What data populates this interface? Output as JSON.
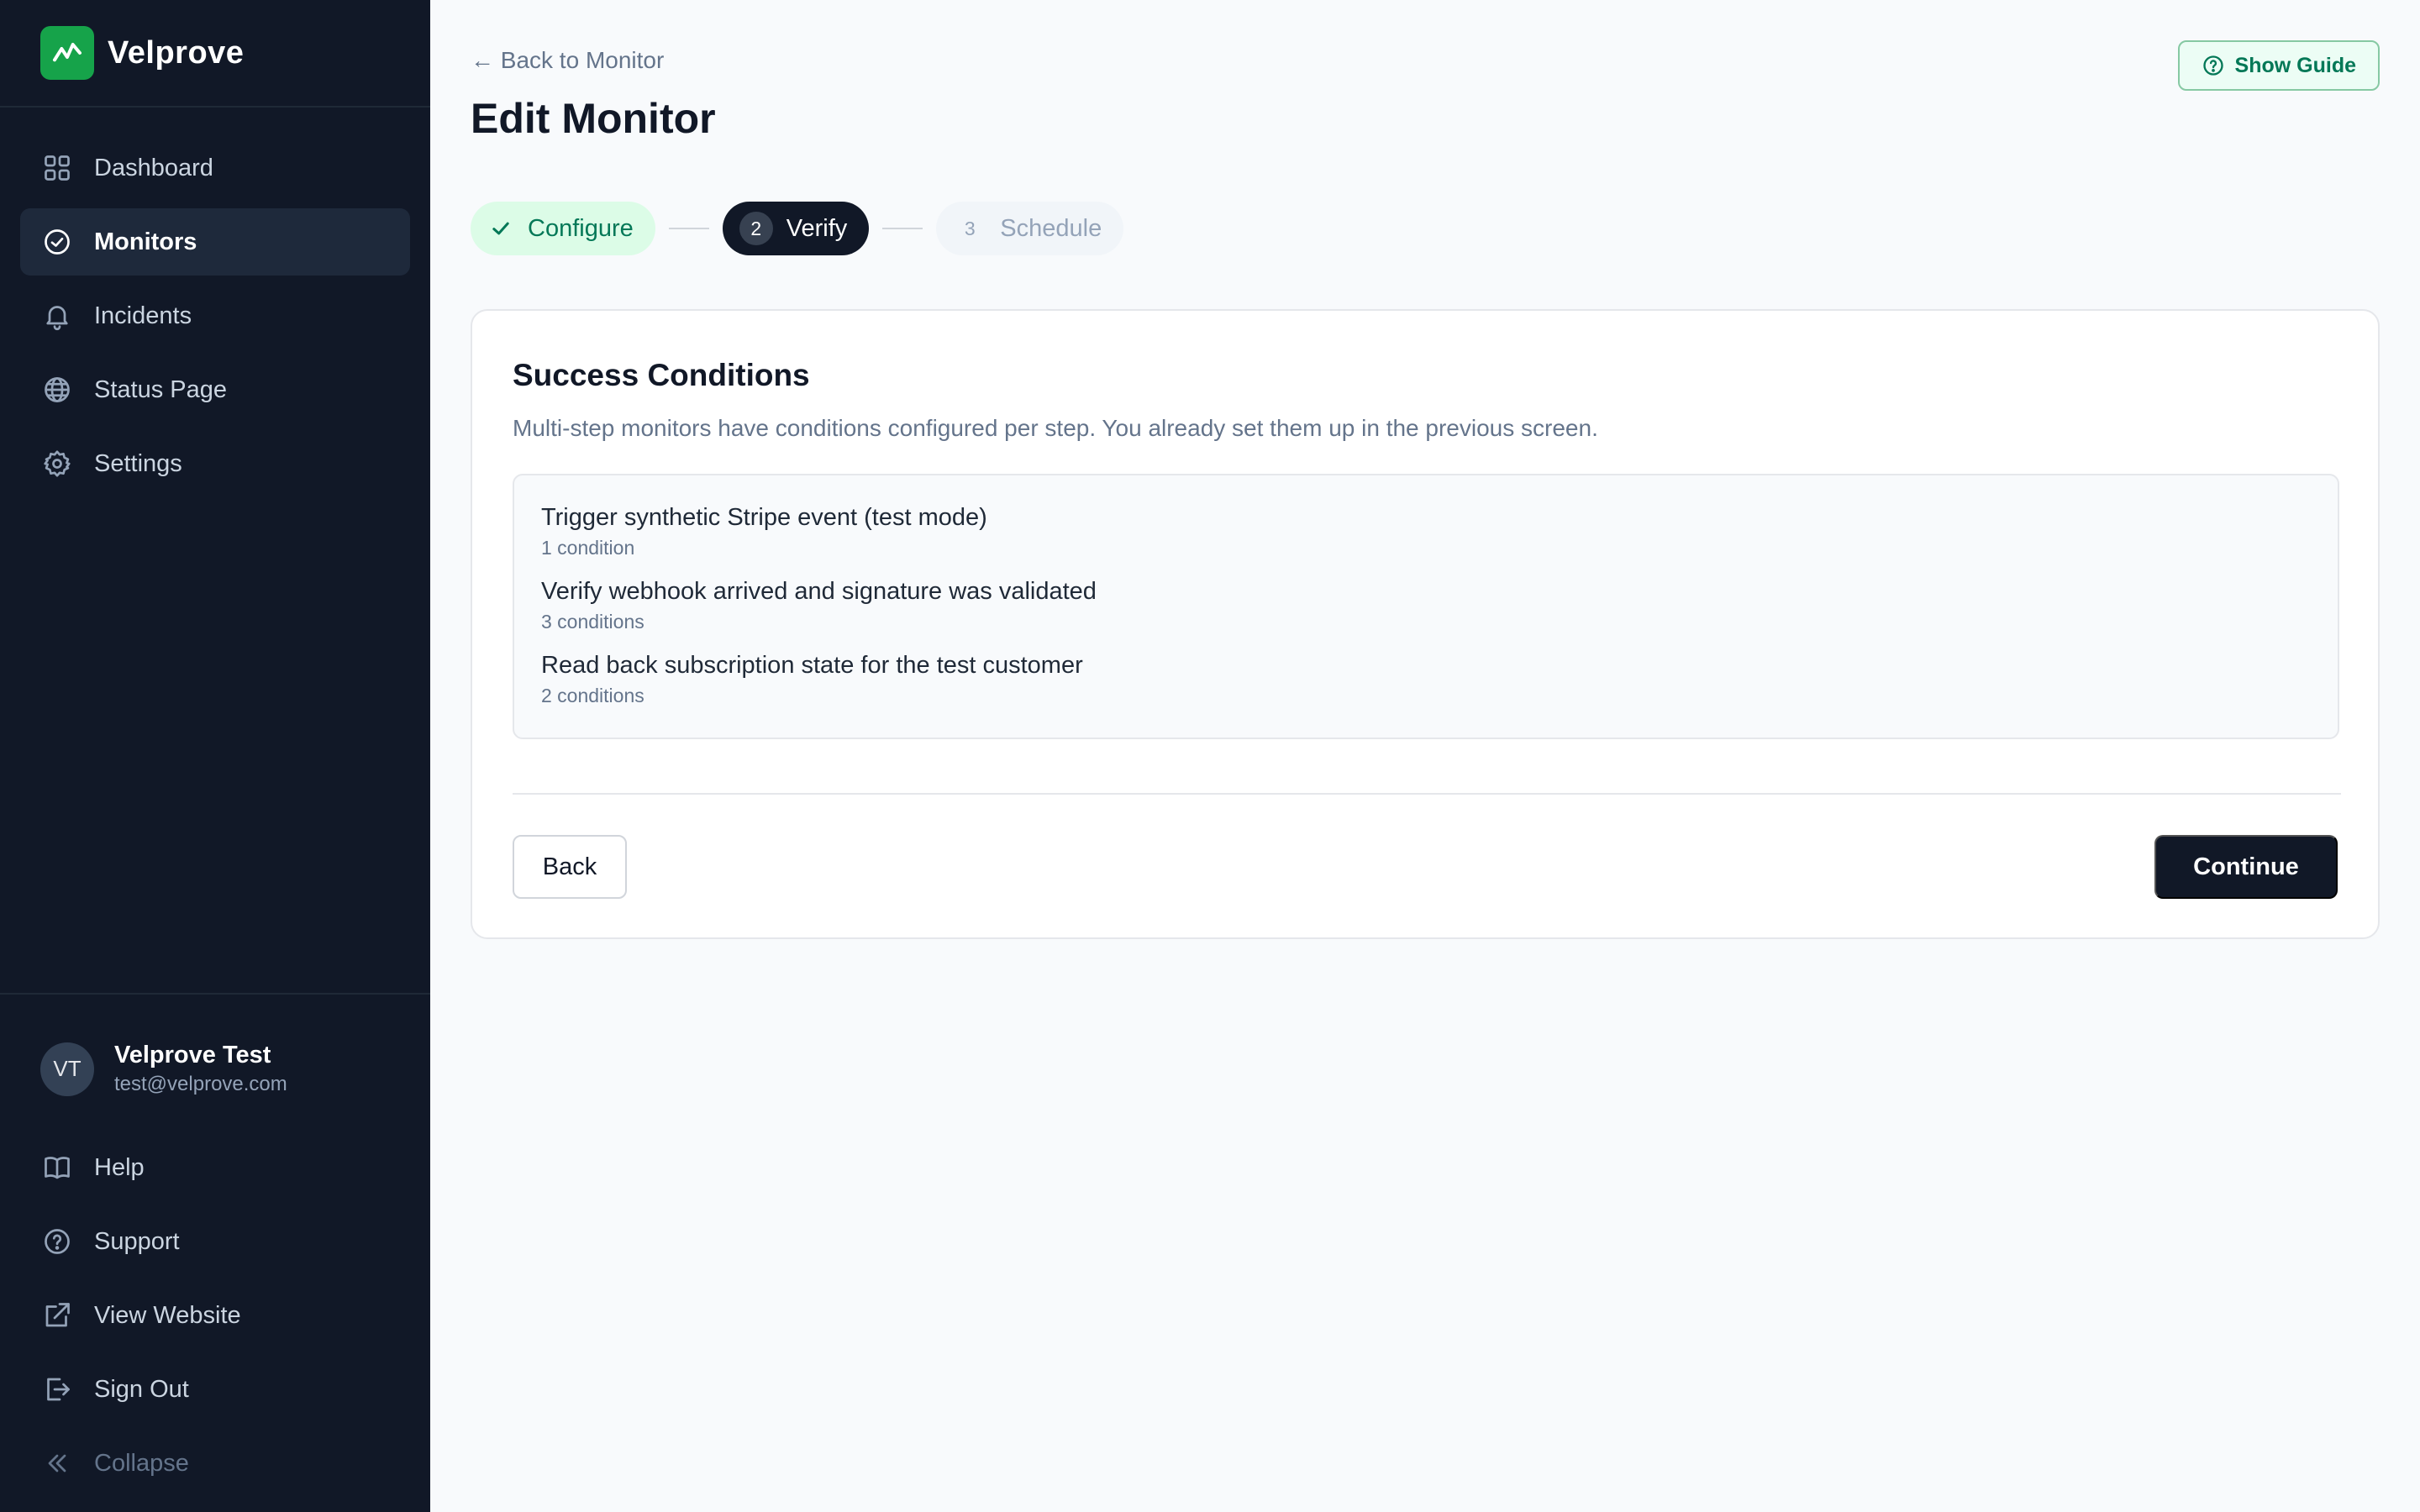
{
  "brand": {
    "name": "Velprove",
    "logo_icon": "pulse-icon",
    "accent": "#16a34a"
  },
  "sidebar": {
    "items": [
      {
        "label": "Dashboard",
        "icon": "grid-icon",
        "active": false
      },
      {
        "label": "Monitors",
        "icon": "check-circle-icon",
        "active": true
      },
      {
        "label": "Incidents",
        "icon": "bell-icon",
        "active": false
      },
      {
        "label": "Status Page",
        "icon": "globe-icon",
        "active": false
      },
      {
        "label": "Settings",
        "icon": "gear-icon",
        "active": false
      }
    ],
    "user": {
      "initials": "VT",
      "name": "Velprove Test",
      "email": "test@velprove.com"
    },
    "bottom_items": [
      {
        "label": "Help",
        "icon": "book-icon"
      },
      {
        "label": "Support",
        "icon": "help-circle-icon"
      },
      {
        "label": "View Website",
        "icon": "external-link-icon"
      },
      {
        "label": "Sign Out",
        "icon": "sign-out-icon"
      },
      {
        "label": "Collapse",
        "icon": "chevrons-left-icon"
      }
    ]
  },
  "main": {
    "back_link": "← Back to Monitor",
    "title": "Edit Monitor",
    "guide_button": "Show Guide",
    "stepper": [
      {
        "label": "Configure",
        "state": "done"
      },
      {
        "number": "2",
        "label": "Verify",
        "state": "current"
      },
      {
        "number": "3",
        "label": "Schedule",
        "state": "todo"
      }
    ],
    "card": {
      "title": "Success Conditions",
      "description": "Multi-step monitors have conditions configured per step. You already set them up in the previous screen.",
      "steps": [
        {
          "title": "Trigger synthetic Stripe event (test mode)",
          "count": "1 condition"
        },
        {
          "title": "Verify webhook arrived and signature was validated",
          "count": "3 conditions"
        },
        {
          "title": "Read back subscription state for the test customer",
          "count": "2 conditions"
        }
      ],
      "back_button": "Back",
      "continue_button": "Continue"
    }
  },
  "colors": {
    "sidebar_bg": "#111827",
    "page_bg": "#f8fafc",
    "success": "#047857",
    "primary_button": "#111827"
  }
}
